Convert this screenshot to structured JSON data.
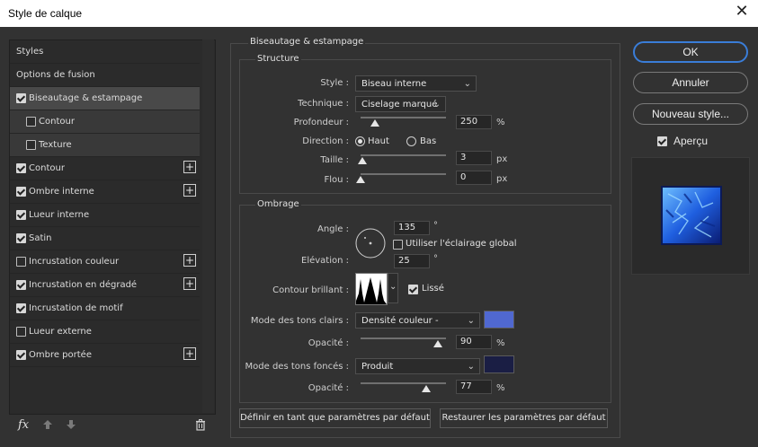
{
  "window": {
    "title": "Style de calque"
  },
  "left_panel": {
    "items": [
      {
        "label": "Styles",
        "checkbox": null,
        "plus": false
      },
      {
        "label": "Options de fusion",
        "checkbox": null,
        "plus": false
      },
      {
        "label": "Biseautage & estampage",
        "checkbox": true,
        "plus": false,
        "selected": true
      },
      {
        "label": "Contour",
        "checkbox": false,
        "plus": false,
        "sub": true
      },
      {
        "label": "Texture",
        "checkbox": false,
        "plus": false,
        "sub": true
      },
      {
        "label": "Contour",
        "checkbox": true,
        "plus": true
      },
      {
        "label": "Ombre interne",
        "checkbox": true,
        "plus": true
      },
      {
        "label": "Lueur interne",
        "checkbox": true,
        "plus": false
      },
      {
        "label": "Satin",
        "checkbox": true,
        "plus": false
      },
      {
        "label": "Incrustation couleur",
        "checkbox": false,
        "plus": true
      },
      {
        "label": "Incrustation en dégradé",
        "checkbox": true,
        "plus": true
      },
      {
        "label": "Incrustation de motif",
        "checkbox": true,
        "plus": false
      },
      {
        "label": "Lueur externe",
        "checkbox": false,
        "plus": false
      },
      {
        "label": "Ombre portée",
        "checkbox": true,
        "plus": true
      }
    ],
    "footer": {
      "fx": "fx",
      "up_icon": "arrow-up-icon",
      "down_icon": "arrow-down-icon",
      "trash_icon": "trash-icon"
    }
  },
  "main": {
    "heading": "Biseautage & estampage",
    "structure": {
      "legend": "Structure",
      "style_label": "Style :",
      "style_value": "Biseau interne",
      "technique_label": "Technique :",
      "technique_value": "Ciselage marqué",
      "profondeur_label": "Profondeur :",
      "profondeur_value": "250",
      "profondeur_unit": "%",
      "profondeur_level": 0.17,
      "direction_label": "Direction :",
      "direction_haut": "Haut",
      "direction_bas": "Bas",
      "taille_label": "Taille :",
      "taille_value": "3",
      "taille_unit": "px",
      "taille_level": 0.02,
      "flou_label": "Flou :",
      "flou_value": "0",
      "flou_unit": "px",
      "flou_level": 0.0
    },
    "ombrage": {
      "legend": "Ombrage",
      "angle_label": "Angle :",
      "angle_value": "135",
      "angle_unit": "°",
      "global_light_label": "Utiliser l'éclairage global",
      "elevation_label": "Elévation :",
      "elevation_value": "25",
      "elevation_unit": "°",
      "contour_label": "Contour brillant :",
      "lisse_label": "Lissé",
      "highlight_mode_label": "Mode des tons clairs :",
      "highlight_mode_value": "Densité couleur -",
      "highlight_color": "#5068d0",
      "highlight_opacity_label": "Opacité :",
      "highlight_opacity_value": "90",
      "highlight_opacity_unit": "%",
      "highlight_opacity_level": 0.9,
      "shadow_mode_label": "Mode des tons foncés :",
      "shadow_mode_value": "Produit",
      "shadow_color": "#1a1e44",
      "shadow_opacity_label": "Opacité :",
      "shadow_opacity_value": "77",
      "shadow_opacity_unit": "%",
      "shadow_opacity_level": 0.77
    },
    "buttons": {
      "set_default": "Définir en tant que paramètres par défaut",
      "reset_default": "Restaurer les paramètres par défaut"
    }
  },
  "right": {
    "ok": "OK",
    "cancel": "Annuler",
    "new_style": "Nouveau style...",
    "preview_label": "Aperçu"
  }
}
